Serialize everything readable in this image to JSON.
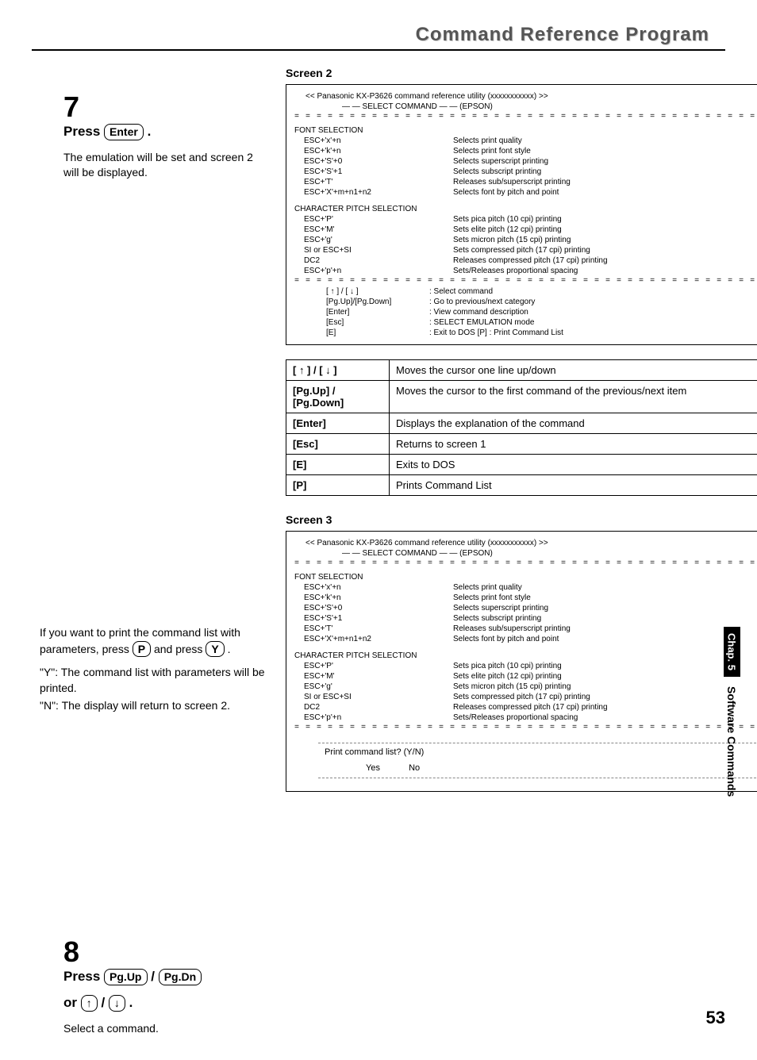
{
  "header": {
    "title": "Command Reference Program"
  },
  "step7": {
    "num": "7",
    "title_pre": "Press ",
    "key": "Enter",
    "title_post": " .",
    "desc": "The emulation will be set and screen 2 will be displayed."
  },
  "step7b": {
    "para": "If you want to print the command list with parameters, press",
    "key_p_text": "P",
    "mid": "and press",
    "key_y_text": "Y",
    "post": ".",
    "lineY": "\"Y\": The command list with parameters will be printed.",
    "lineN": "\"N\": The display will return to screen 2."
  },
  "step8": {
    "num": "8",
    "title_pre": "Press ",
    "k1": "Pg.Up",
    "sep1": " / ",
    "k2": "Pg.Dn",
    "line2_pre": "or ",
    "k3": "↑",
    "sep2": " / ",
    "k4": "↓",
    "post": " .",
    "desc": "Select a command."
  },
  "screen2": {
    "label": "Screen 2",
    "head1": "<<   Panasonic KX-P3626 command reference utility (xxxxxxxxxxx)   >>",
    "head2": "— — SELECT COMMAND — —       (EPSON)",
    "font_section": "FONT SELECTION",
    "font_rows": [
      {
        "l": "ESC+'x'+n",
        "r": "Selects print quality"
      },
      {
        "l": "ESC+'k'+n",
        "r": "Selects print font style"
      },
      {
        "l": "ESC+'S'+0",
        "r": "Selects superscript printing"
      },
      {
        "l": "ESC+'S'+1",
        "r": "Selects subscript printing"
      },
      {
        "l": "ESC+'T'",
        "r": "Releases sub/superscript printing"
      },
      {
        "l": "ESC+'X'+m+n1+n2",
        "r": "Selects font by pitch and point"
      }
    ],
    "pitch_section": "CHARACTER PITCH SELECTION",
    "pitch_rows": [
      {
        "l": "ESC+'P'",
        "r": "Sets pica pitch (10 cpi) printing"
      },
      {
        "l": "ESC+'M'",
        "r": "Sets elite pitch (12 cpi) printing"
      },
      {
        "l": "ESC+'g'",
        "r": "Sets micron pitch (15 cpi) printing"
      },
      {
        "l": "SI or ESC+SI",
        "r": "Sets compressed pitch (17 cpi) printing"
      },
      {
        "l": "DC2",
        "r": "Releases compressed pitch (17 cpi) printing"
      },
      {
        "l": "ESC+'p'+n",
        "r": "Sets/Releases proportional spacing"
      }
    ],
    "help_rows": [
      {
        "l": "[ ↑ ] / [ ↓ ]",
        "r": ": Select command"
      },
      {
        "l": "[Pg.Up]/[Pg.Down]",
        "r": ": Go to previous/next category"
      },
      {
        "l": "[Enter]",
        "r": ": View command description"
      },
      {
        "l": "[Esc]",
        "r": ": SELECT EMULATION mode"
      },
      {
        "l": "[E]",
        "r": ": Exit to DOS            [P] : Print Command List"
      }
    ]
  },
  "keytable": [
    {
      "k": "[ ↑ ] / [ ↓ ]",
      "d": "Moves the cursor one line up/down"
    },
    {
      "k": "[Pg.Up] / [Pg.Down]",
      "d": "Moves the cursor to the first command of the previous/next item"
    },
    {
      "k": "[Enter]",
      "d": "Displays the explanation of the command"
    },
    {
      "k": "[Esc]",
      "d": "Returns to screen 1"
    },
    {
      "k": "[E]",
      "d": "Exits to DOS"
    },
    {
      "k": "[P]",
      "d": "Prints Command List"
    }
  ],
  "screen3": {
    "label": "Screen 3",
    "prompt": "Print command list?    (Y/N)",
    "yes": "Yes",
    "no": "No"
  },
  "sidetab": {
    "dark": "Chap. 5",
    "light": "Software Commands"
  },
  "page": "53"
}
